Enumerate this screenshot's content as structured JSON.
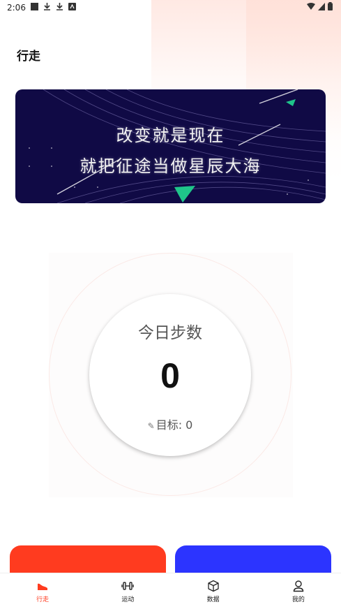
{
  "status_bar": {
    "time": "2:06"
  },
  "header": {
    "title": "行走"
  },
  "banner": {
    "line1": "改变就是现在",
    "line2": "就把征途当做星辰大海"
  },
  "steps": {
    "label": "今日步数",
    "value": "0",
    "goal_text": "目标: 0"
  },
  "tabs": [
    {
      "label": "行走",
      "icon": "shoe-icon",
      "active": true
    },
    {
      "label": "运动",
      "icon": "dumbbell-icon",
      "active": false
    },
    {
      "label": "数据",
      "icon": "cube-icon",
      "active": false
    },
    {
      "label": "我的",
      "icon": "user-icon",
      "active": false
    }
  ],
  "colors": {
    "accent": "#ff3b1f",
    "card_red": "#ff3b1f",
    "card_blue": "#2c34ff",
    "banner_bg": "#100a45",
    "banner_triangle": "#1fc58a"
  }
}
